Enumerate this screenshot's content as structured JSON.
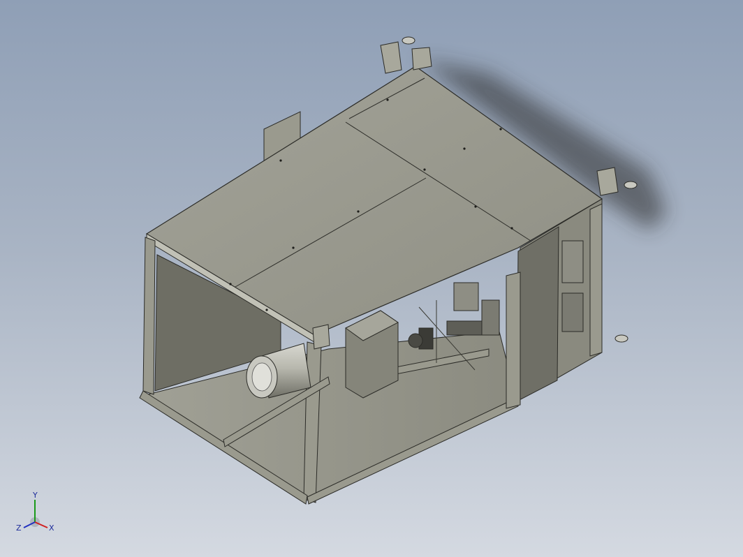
{
  "viewport": {
    "background_top": "#8f9fb6",
    "background_bottom": "#d4d9e1"
  },
  "model": {
    "body_color": "#9b9b8f",
    "frame_color": "#8c8c80",
    "edge_color": "#2b2b27"
  },
  "triad": {
    "x_label": "X",
    "y_label": "Y",
    "z_label": "Z",
    "x_color": "#d02020",
    "y_color": "#1a9a1a",
    "z_color": "#2030c0"
  }
}
